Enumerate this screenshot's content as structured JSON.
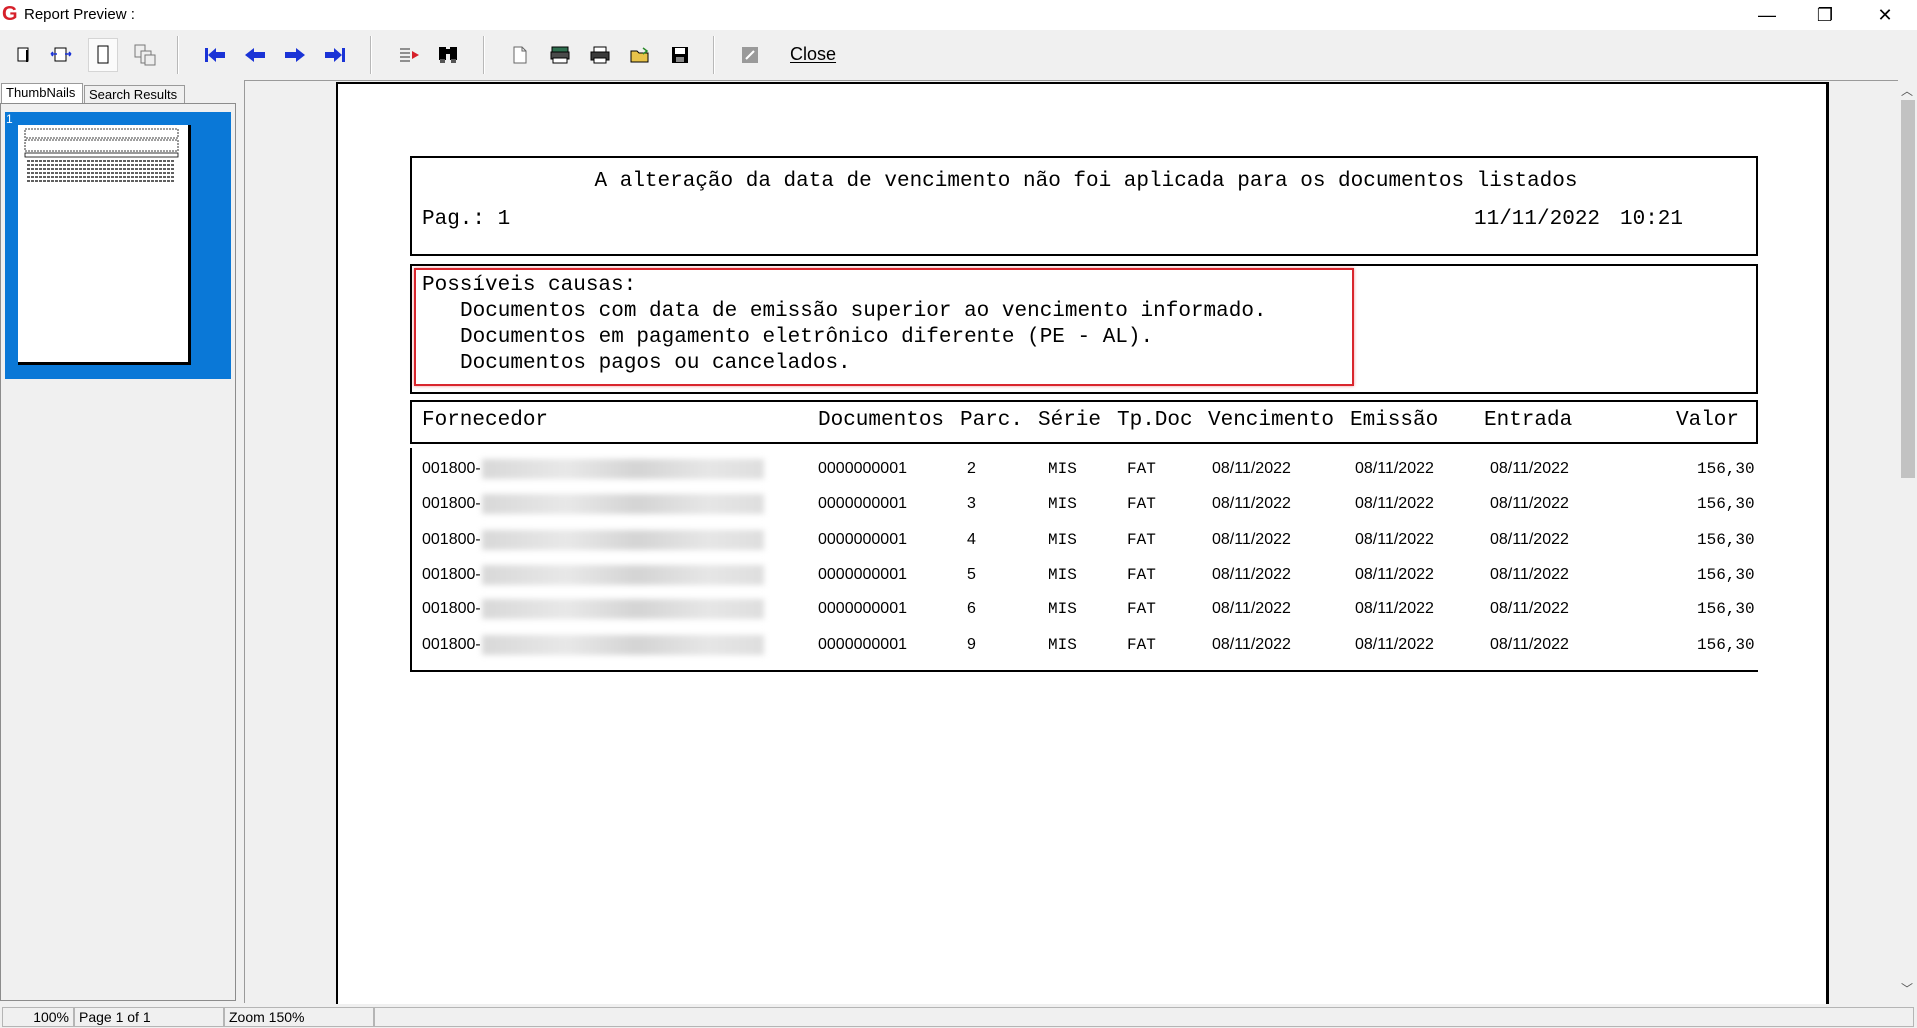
{
  "window": {
    "title": "Report Preview :",
    "minimize": "—",
    "maximize": "❐",
    "close": "✕"
  },
  "toolbar": {
    "close_label": "Close",
    "icons": [
      "single-page-icon",
      "page-width-icon",
      "full-page-icon",
      "multi-page-icon",
      "first-page-icon",
      "previous-page-icon",
      "next-page-icon",
      "last-page-icon",
      "go-to-page-icon",
      "find-icon",
      "page-setup-icon",
      "printer-setup-icon",
      "print-icon",
      "open-icon",
      "save-icon",
      "edit-icon"
    ]
  },
  "left_panel": {
    "tabs": [
      "ThumbNails",
      "Search Results"
    ],
    "thumb_number": "1"
  },
  "report": {
    "title": "A alteração da data de vencimento não foi aplicada para os documentos listados",
    "page_label": "Pag.:",
    "page_number": "1",
    "date": "11/11/2022",
    "time": "10:21",
    "causes_title": "Possíveis causas:",
    "causes": [
      "Documentos com data de emissão superior ao vencimento informado.",
      "Documentos em pagamento eletrônico diferente (PE - AL).",
      "Documentos pagos ou cancelados."
    ],
    "columns": [
      "Fornecedor",
      "Documentos",
      "Parc.",
      "Série",
      "Tp.Doc",
      "Vencimento",
      "Emissão",
      "Entrada",
      "Valor"
    ],
    "rows": [
      {
        "fornecedor": "001800-",
        "documento": "0000000001",
        "parc": "2",
        "serie": "MIS",
        "tpdoc": "FAT",
        "vencimento": "08/11/2022",
        "emissao": "08/11/2022",
        "entrada": "08/11/2022",
        "valor": "156,30"
      },
      {
        "fornecedor": "001800-",
        "documento": "0000000001",
        "parc": "3",
        "serie": "MIS",
        "tpdoc": "FAT",
        "vencimento": "08/11/2022",
        "emissao": "08/11/2022",
        "entrada": "08/11/2022",
        "valor": "156,30"
      },
      {
        "fornecedor": "001800-",
        "documento": "0000000001",
        "parc": "4",
        "serie": "MIS",
        "tpdoc": "FAT",
        "vencimento": "08/11/2022",
        "emissao": "08/11/2022",
        "entrada": "08/11/2022",
        "valor": "156,30"
      },
      {
        "fornecedor": "001800-",
        "documento": "0000000001",
        "parc": "5",
        "serie": "MIS",
        "tpdoc": "FAT",
        "vencimento": "08/11/2022",
        "emissao": "08/11/2022",
        "entrada": "08/11/2022",
        "valor": "156,30"
      },
      {
        "fornecedor": "001800-",
        "documento": "0000000001",
        "parc": "6",
        "serie": "MIS",
        "tpdoc": "FAT",
        "vencimento": "08/11/2022",
        "emissao": "08/11/2022",
        "entrada": "08/11/2022",
        "valor": "156,30"
      },
      {
        "fornecedor": "001800-",
        "documento": "0000000001",
        "parc": "9",
        "serie": "MIS",
        "tpdoc": "FAT",
        "vencimento": "08/11/2022",
        "emissao": "08/11/2022",
        "entrada": "08/11/2022",
        "valor": "156,30"
      }
    ]
  },
  "statusbar": {
    "zoom_percent": "100%",
    "page_info": "Page 1 of 1",
    "zoom_label": "Zoom 150%"
  },
  "colors": {
    "selection": "#0a78d7",
    "highlight_border": "#d9262d",
    "nav_arrows": "#1a33d6"
  }
}
